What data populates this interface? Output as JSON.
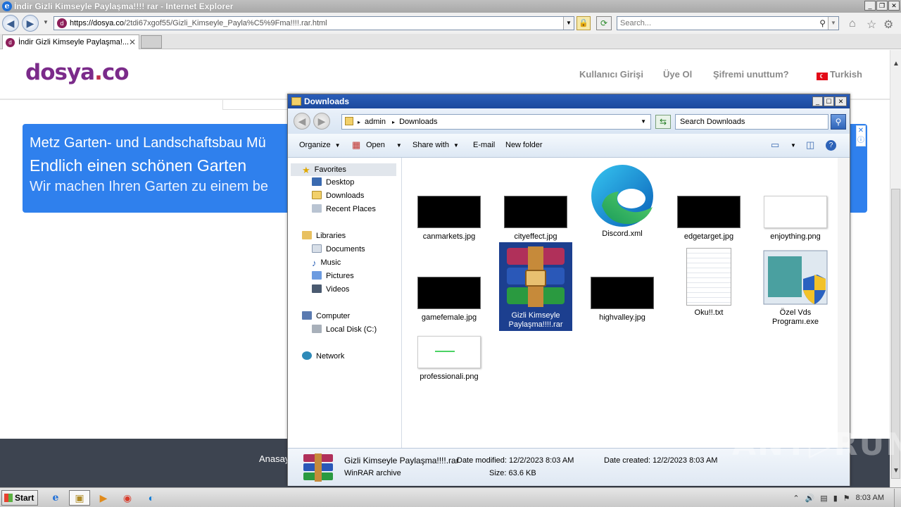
{
  "ie": {
    "title": "İndir Gizli Kimseyle Paylaşma!!!! rar - Internet Explorer",
    "address_host": "https://dosya.co",
    "address_path": "/2tdi67xgof55/Gizli_Kimseyle_Payla%C5%9Fma!!!!.rar.html",
    "search_placeholder": "Search...",
    "tab_label": "İndir Gizli Kimseyle Paylaşma!..."
  },
  "site": {
    "logo_a": "d",
    "logo_b": "o",
    "logo_c": "sya",
    "logo_dot": ".",
    "logo_d": "co",
    "nav": [
      "Kullanıcı Girişi",
      "Üye Ol",
      "Şifremi unuttum?",
      "Turkish"
    ],
    "ad_line1": "Metz Garten- und Landschaftsbau Mü",
    "ad_line2": "Endlich einen schönen Garten",
    "ad_line3": "Wir machen Ihren Garten zu einem be",
    "footer_link": "Anasay",
    "watermark": "ANY▷RUN"
  },
  "explorer": {
    "title": "Downloads",
    "breadcrumb": [
      "admin",
      "Downloads"
    ],
    "search_placeholder": "Search Downloads",
    "commands": [
      "Organize",
      "Open",
      "Share with",
      "E-mail",
      "New folder"
    ],
    "tree": {
      "favorites": "Favorites",
      "desktop": "Desktop",
      "downloads": "Downloads",
      "recent": "Recent Places",
      "libraries": "Libraries",
      "documents": "Documents",
      "music": "Music",
      "pictures": "Pictures",
      "videos": "Videos",
      "computer": "Computer",
      "local_disk": "Local Disk (C:)",
      "network": "Network"
    },
    "files": [
      {
        "name": "canmarkets.jpg",
        "kind": "dark"
      },
      {
        "name": "cityeffect.jpg",
        "kind": "dark"
      },
      {
        "name": "Discord.xml",
        "kind": "edge"
      },
      {
        "name": "edgetarget.jpg",
        "kind": "dark"
      },
      {
        "name": "enjoything.png",
        "kind": "white"
      },
      {
        "name": "gamefemale.jpg",
        "kind": "dark"
      },
      {
        "name": "Gizli Kimseyle Paylaşma!!!!.rar",
        "kind": "rar"
      },
      {
        "name": "highvalley.jpg",
        "kind": "dark"
      },
      {
        "name": "Oku!!.txt",
        "kind": "txt"
      },
      {
        "name": "Özel Vds Programı.exe",
        "kind": "exe"
      },
      {
        "name": "professionali.png",
        "kind": "white"
      }
    ],
    "details": {
      "name": "Gizli Kimseyle Paylaşma!!!!.rar",
      "type": "WinRAR archive",
      "modified_label": "Date modified:",
      "modified": "12/2/2023 8:03 AM",
      "created_label": "Date created:",
      "created": "12/2/2023 8:03 AM",
      "size_label": "Size:",
      "size": "63.6 KB"
    }
  },
  "taskbar": {
    "start": "Start",
    "clock": "8:03 AM"
  },
  "colors": {
    "ad_blue": "#2f80ed",
    "selection": "#1c3f8f",
    "footer": "#3d4450",
    "logo_purple": "#7b2b8a"
  }
}
